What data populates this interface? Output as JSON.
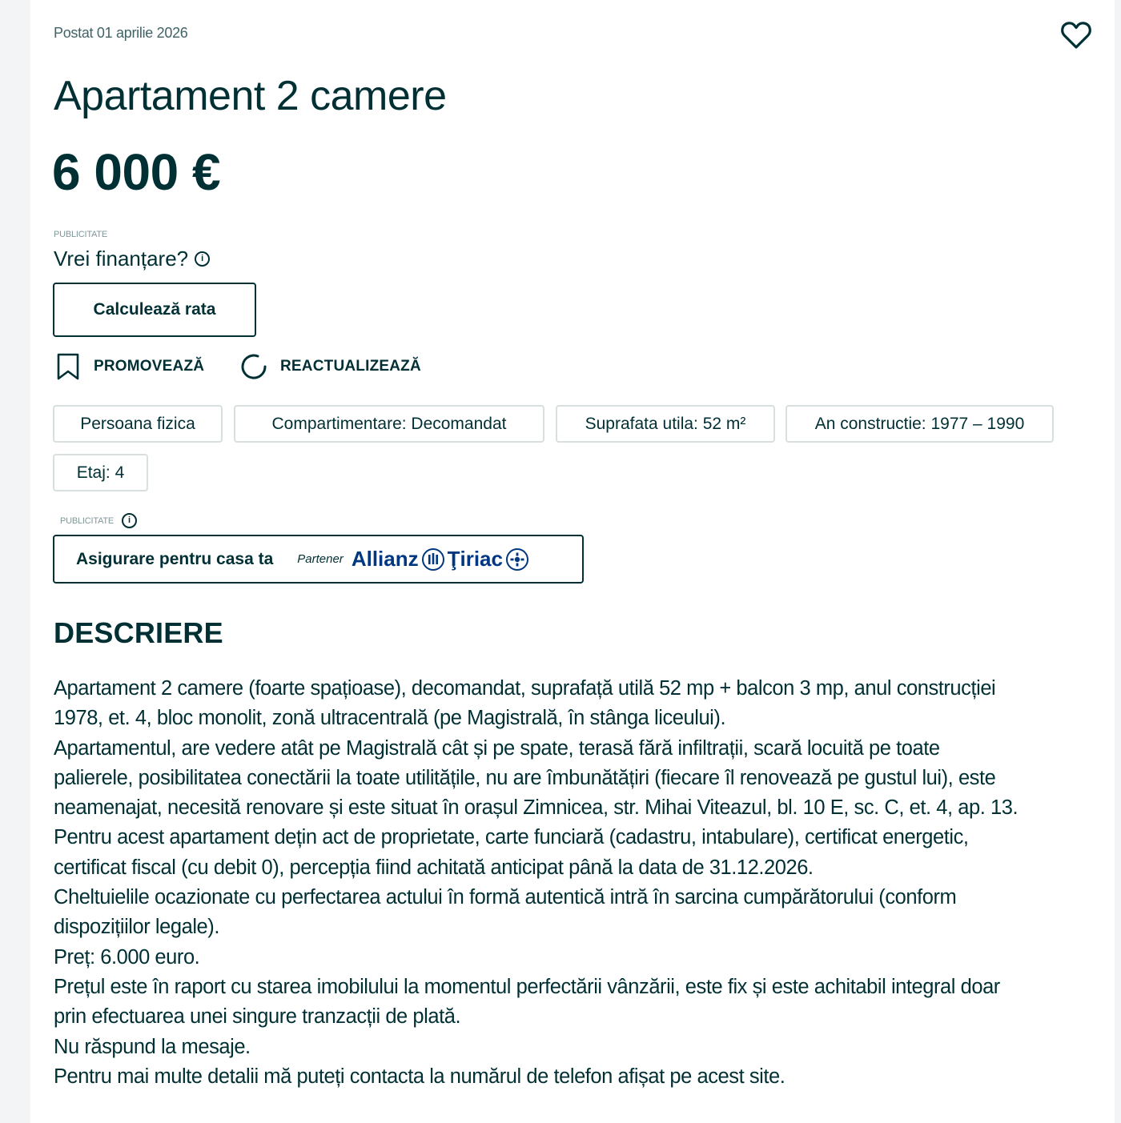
{
  "listing": {
    "posted": "Postat 01 aprilie 2026",
    "title": "Apartament 2 camere",
    "price": "6 000 €"
  },
  "financing": {
    "ad_label": "PUBLICITATE",
    "question": "Vrei finanțare?",
    "calc_button": "Calculează rata"
  },
  "actions": {
    "promote": "PROMOVEAZĂ",
    "refresh": "REACTUALIZEAZĂ"
  },
  "tags": [
    "Persoana fizica",
    "Compartimentare: Decomandat",
    "Suprafata utila: 52 m²",
    "An constructie: 1977 – 1990",
    "Etaj: 4"
  ],
  "insurance": {
    "ad_label": "PUBLICITATE",
    "label": "Asigurare pentru casa ta",
    "partner": "Partener",
    "brand": "Allianz",
    "brand2": "Ţiriac",
    "brand_color": "#003781"
  },
  "description": {
    "heading": "DESCRIERE",
    "lines": [
      "Apartament 2 camere (foarte spațioase), decomandat, suprafață utilă 52 mp + balcon 3 mp, anul construcției",
      "1978, et. 4, bloc monolit, zonă ultracentrală (pe Magistrală, în stânga liceului).",
      "Apartamentul, are vedere atât pe Magistrală cât și pe spate, terasă fără infiltrații, scară locuită pe toate",
      "palierele, posibilitatea conectării la toate utilitățile, nu are îmbunătățiri (fiecare îl renovează pe gustul lui), este",
      "neamenajat, necesită renovare și este situat în orașul Zimnicea, str. Mihai Viteazul, bl. 10 E, sc. C, et. 4, ap. 13.",
      "Pentru acest apartament dețin act de proprietate, carte funciară (cadastru, intabulare), certificat energetic,",
      "certificat fiscal (cu debit 0), percepția fiind achitată anticipat până la data de 31.12.2026.",
      "Cheltuielile ocazionate cu perfectarea actului în formă autentică intră în sarcina cumpărătorului (conform",
      "dispozițiilor legale).",
      "Preț: 6.000 euro.",
      "Prețul este în raport cu starea imobilului la momentul perfectării vânzării, este fix și este achitabil integral doar",
      "prin efectuarea unei singure tranzacții de plată.",
      "Nu răspund la mesaje.",
      "Pentru mai multe detalii mă puteți contacta la numărul de telefon afișat pe acest site."
    ]
  },
  "icons": {
    "favorite": "heart-icon",
    "info": "info-icon",
    "promote": "bookmark-icon",
    "refresh": "refresh-icon",
    "brand": "allianz-logo"
  }
}
